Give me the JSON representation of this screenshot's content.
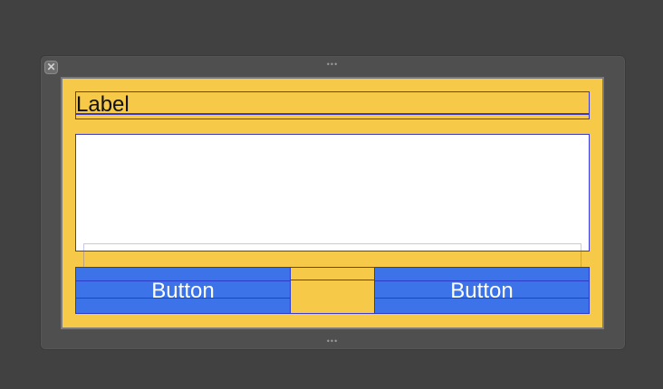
{
  "window": {
    "close_glyph": "✕",
    "grip_glyph": "•••"
  },
  "canvas": {
    "background_color": "#f7c948",
    "label_text": "Label",
    "left_button_label": "Button",
    "right_button_label": "Button",
    "button_color": "#3d73e8",
    "outline_color": "#3a3ad0"
  }
}
